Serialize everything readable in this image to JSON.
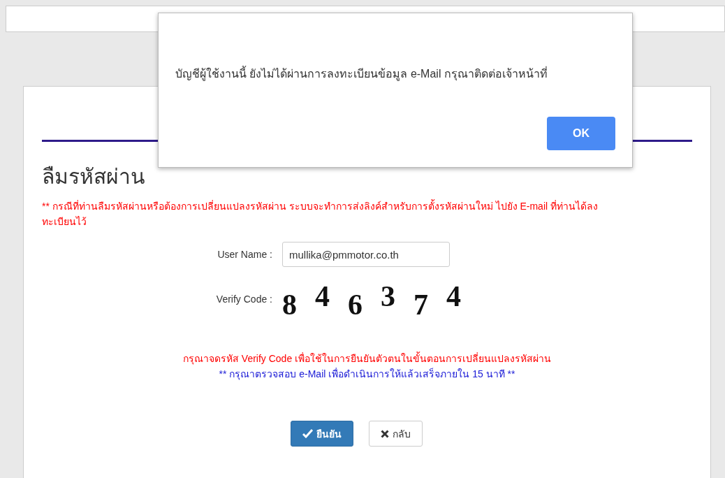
{
  "page": {
    "title": "ลืมรหัสผ่าน",
    "notice": "** กรณีที่ท่านลืมรหัสผ่านหรือต้องการเปลี่ยนแปลงรหัสผ่าน ระบบจะทำการส่งลิงค์สำหรับการตั้งรหัสผ่านใหม่ ไปยัง E-mail ที่ท่านได้ลงทะเบียนไว้",
    "username_label": "User Name :",
    "username_value": "mullika@pmmotor.co.th",
    "verify_label": "Verify Code :",
    "verify_digits": [
      "8",
      "4",
      "6",
      "3",
      "7",
      "4"
    ],
    "hint_red": "กรุณาจดรหัส Verify Code เพื่อใช้ในการยืนยันตัวตนในขั้นตอนการเปลี่ยนแปลงรหัสผ่าน",
    "hint_blue": "** กรุณาตรวจสอบ e-Mail เพื่อดำเนินการให้แล้วเสร็จภายใน 15 นาที **",
    "buttons": [
      {
        "kind": "confirm",
        "label": "ยืนยัน"
      },
      {
        "kind": "back",
        "label": "กลับ"
      }
    ]
  },
  "dialog": {
    "message": "บัญชีผู้ใช้งานนี้ ยังไม่ได้ผ่านการลงทะเบียนข้อมูล e-Mail กรุณาติดต่อเจ้าหน้าที่",
    "button": "OK"
  }
}
